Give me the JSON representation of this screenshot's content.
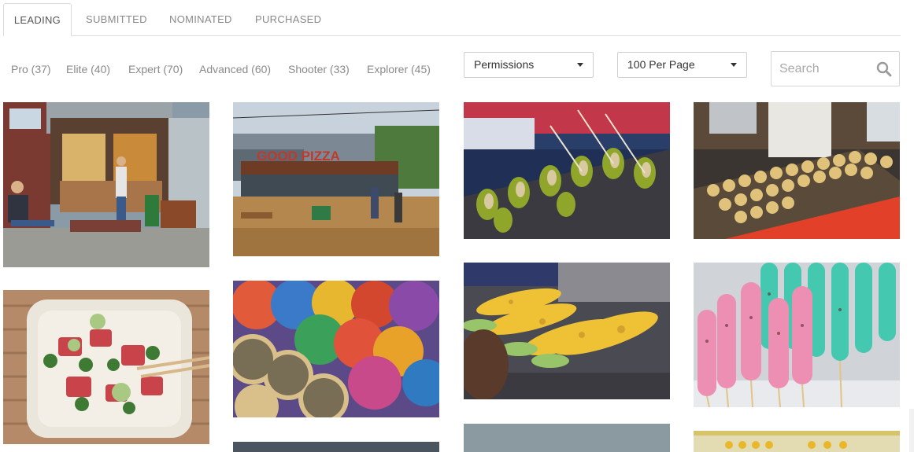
{
  "tabs": [
    {
      "label": "LEADING",
      "active": true
    },
    {
      "label": "SUBMITTED",
      "active": false
    },
    {
      "label": "NOMINATED",
      "active": false
    },
    {
      "label": "PURCHASED",
      "active": false
    }
  ],
  "filters": [
    {
      "label": "Pro (37)"
    },
    {
      "label": "Elite (40)"
    },
    {
      "label": "Expert (70)"
    },
    {
      "label": "Advanced (60)"
    },
    {
      "label": "Shooter (33)"
    },
    {
      "label": "Explorer (45)"
    }
  ],
  "permissions_select": {
    "value": "Permissions"
  },
  "per_page_select": {
    "value": "100 Per Page"
  },
  "search": {
    "placeholder": "Search",
    "value": ""
  },
  "photos": [
    {
      "subject": "cafe storefront with woman seated on bench"
    },
    {
      "subject": "Good Pizza outdoor patio"
    },
    {
      "subject": "grilled snails on skewers"
    },
    {
      "subject": "takoyaki being cooked on griddle"
    },
    {
      "subject": "poke bowl with chopsticks"
    },
    {
      "subject": "rainbow and poppy seed bagels"
    },
    {
      "subject": "grilled corn on the cob"
    },
    {
      "subject": "pink and teal sprinkled dessert skewers"
    },
    {
      "subject": "partially visible photo"
    },
    {
      "subject": "partially visible photo"
    },
    {
      "subject": "partially visible photo"
    }
  ],
  "colors": {
    "tab_border": "#dcdcdc",
    "text_muted": "#8a8a8a",
    "text_dark": "#333333"
  }
}
